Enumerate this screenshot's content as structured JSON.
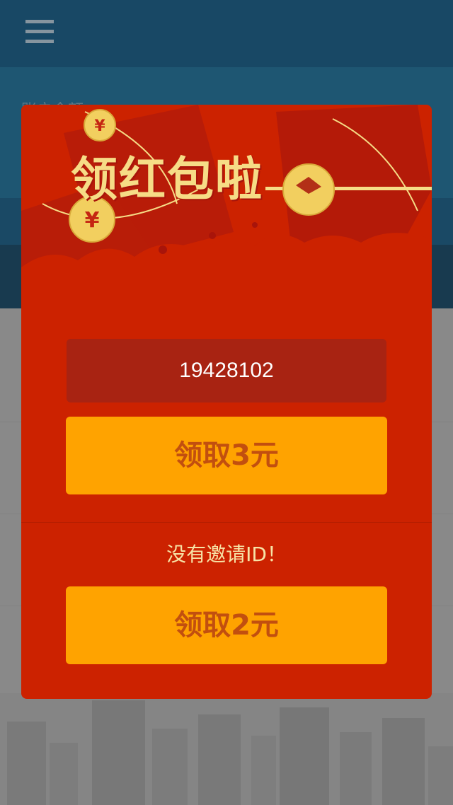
{
  "app": {
    "balance_label": "账户余额"
  },
  "modal": {
    "title": "领红包啦",
    "invite_id": "19428102",
    "claim_with_invite_label": "领取3元",
    "no_invite_text": "没有邀请ID！",
    "claim_without_invite_label": "领取2元"
  },
  "icons": {
    "menu": "hamburger-menu-icon",
    "coin": "yuan-coin-icon"
  },
  "colors": {
    "modal_red": "#cc2200",
    "button_orange": "#ffa300",
    "button_text": "#c24f0f",
    "title_gold": "#f6dc86",
    "header_blue": "#0d4d73"
  }
}
